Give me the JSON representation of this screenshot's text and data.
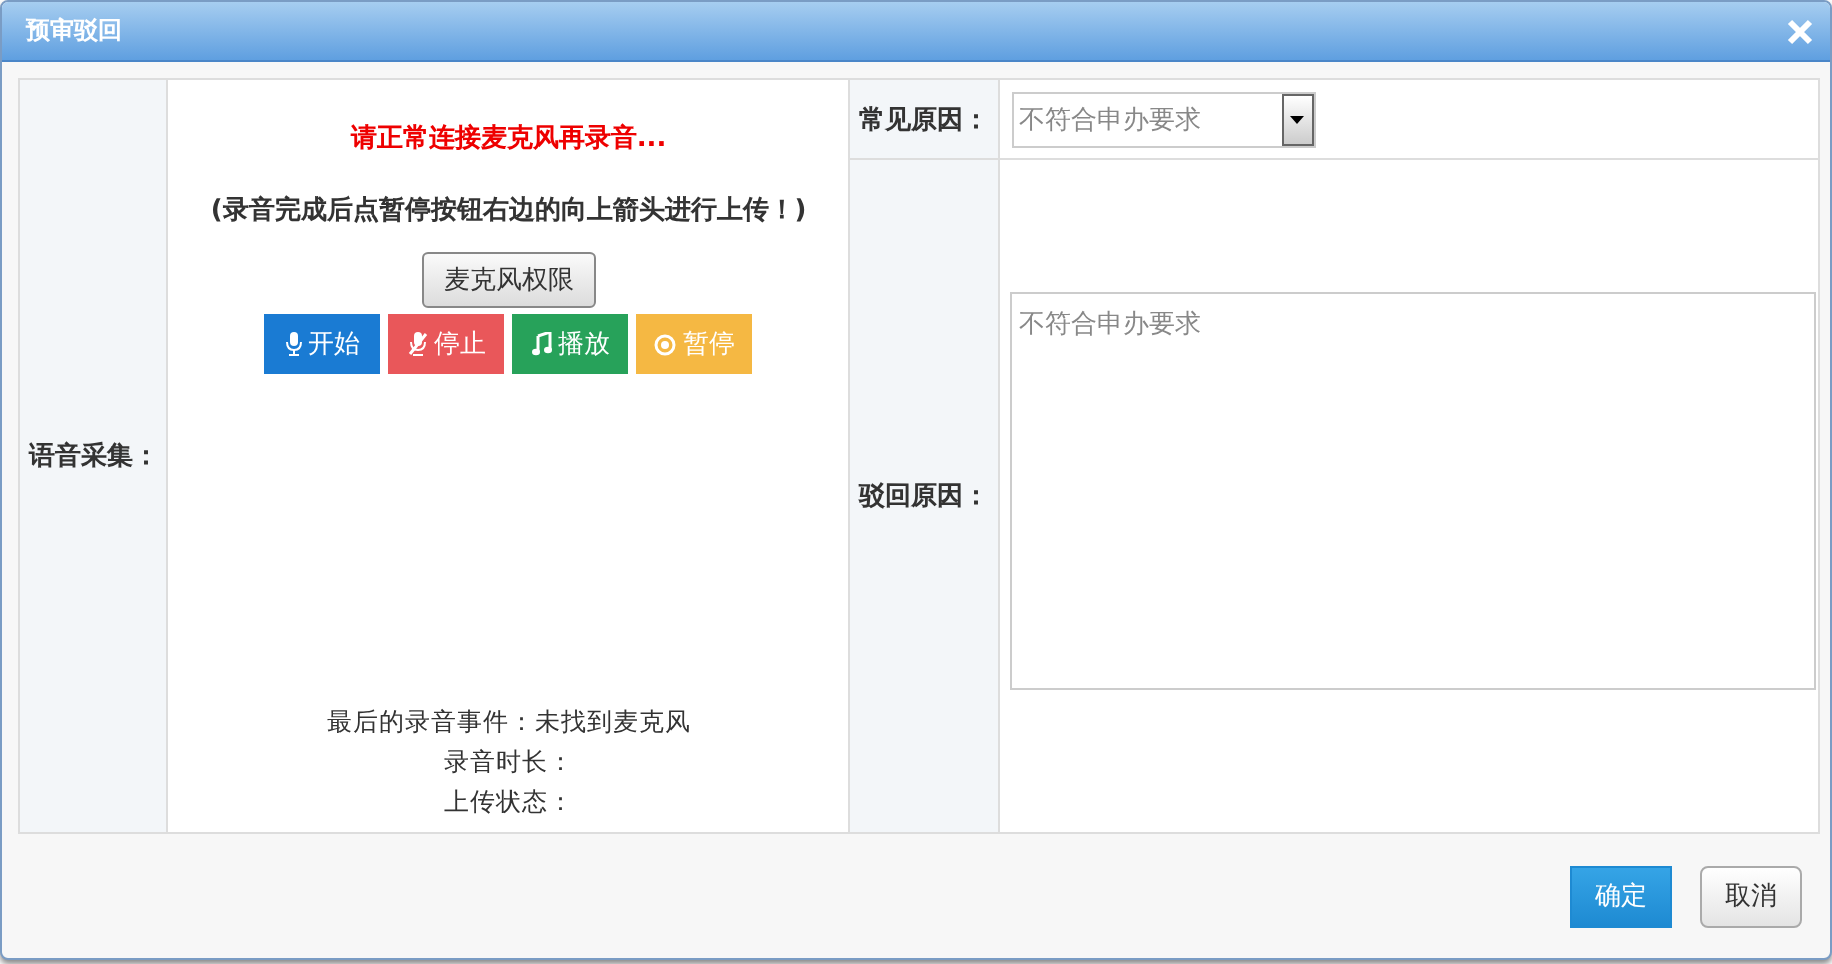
{
  "window": {
    "title": "预审驳回"
  },
  "voice": {
    "label": "语音采集：",
    "warning": "请正常连接麦克风再录音...",
    "hint": "(录音完成后点暂停按钮右边的向上箭头进行上传！)",
    "permission_button": "麦克风权限",
    "controls": [
      {
        "kind": "mic",
        "label": "开始",
        "color": "#1a7bd3"
      },
      {
        "kind": "mic-off",
        "label": "停止",
        "color": "#e9575a"
      },
      {
        "kind": "music",
        "label": "播放",
        "color": "#27a25a"
      },
      {
        "kind": "pause",
        "label": "暂停",
        "color": "#f5b843"
      }
    ],
    "status": [
      "最后的录音事件：未找到麦克风",
      "录音时长：",
      "上传状态："
    ]
  },
  "common_reason": {
    "label": "常见原因：",
    "value": "不符合申办要求"
  },
  "reject_reason": {
    "label": "驳回原因：",
    "placeholder": "不符合申办要求"
  },
  "buttons": [
    {
      "kind": "primary",
      "label": "确定"
    },
    {
      "kind": "default",
      "label": "取消"
    }
  ]
}
